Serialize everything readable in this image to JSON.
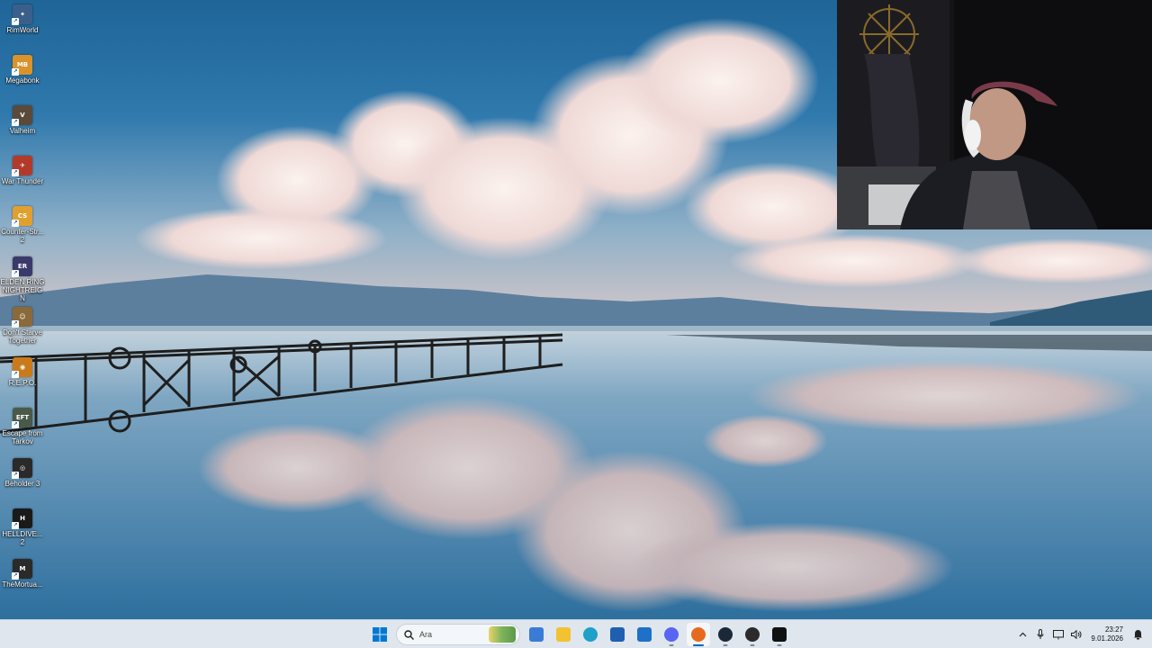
{
  "desktop": {
    "icons": [
      {
        "name": "rimworld-icon",
        "label": "RimWorld",
        "color": "#3a5f8a",
        "glyph": "✦"
      },
      {
        "name": "megabonk-icon",
        "label": "Megabonk",
        "color": "#d9932a",
        "glyph": "MB"
      },
      {
        "name": "valheim-icon",
        "label": "Valheim",
        "color": "#5a4a3a",
        "glyph": "V"
      },
      {
        "name": "war-thunder-icon",
        "label": "War Thunder",
        "color": "#b23a2a",
        "glyph": "✈"
      },
      {
        "name": "counter-strike-2-icon",
        "label": "Counter-Str... 2",
        "color": "#e0a030",
        "glyph": "CS"
      },
      {
        "name": "elden-ring-nightreign-icon",
        "label": "ELDEN RING NIGHTREIGN",
        "color": "#3a3a6a",
        "glyph": "ER"
      },
      {
        "name": "dont-starve-together-icon",
        "label": "Don't Starve Together",
        "color": "#8a6a3a",
        "glyph": "☺"
      },
      {
        "name": "repo-icon",
        "label": "R.E.P.O.",
        "color": "#c97a1a",
        "glyph": "◉"
      },
      {
        "name": "escape-from-tarkov-icon",
        "label": "Escape from Tarkov",
        "color": "#4a5a4a",
        "glyph": "EFT"
      },
      {
        "name": "beholder-3-icon",
        "label": "Beholder 3",
        "color": "#2a2a2a",
        "glyph": "◎"
      },
      {
        "name": "helldivers-2-icon",
        "label": "HELLDIVE... 2",
        "color": "#1a1a1a",
        "glyph": "H"
      },
      {
        "name": "the-mortuary-icon",
        "label": "TheMortua...",
        "color": "#2a2a2a",
        "glyph": "M"
      }
    ]
  },
  "taskbar": {
    "search_placeholder": "Ara",
    "apps": [
      {
        "name": "microsoft-store-icon",
        "color": "#3a7bd5"
      },
      {
        "name": "file-explorer-icon",
        "color": "#f2c230"
      },
      {
        "name": "edge-browser-icon",
        "color": "#1ea0c8"
      },
      {
        "name": "store-bag-icon",
        "color": "#1f5fb0"
      },
      {
        "name": "outlook-icon",
        "color": "#1e70c9"
      },
      {
        "name": "discord-icon",
        "color": "#5865f2"
      },
      {
        "name": "firefox-icon",
        "color": "#e66a1e"
      },
      {
        "name": "steam-icon",
        "color": "#1b2838"
      },
      {
        "name": "obs-icon",
        "color": "#2b2b2b"
      },
      {
        "name": "epic-games-icon",
        "color": "#111111"
      }
    ],
    "tray": {
      "time": "23:27",
      "date": "9.01.2026"
    }
  }
}
